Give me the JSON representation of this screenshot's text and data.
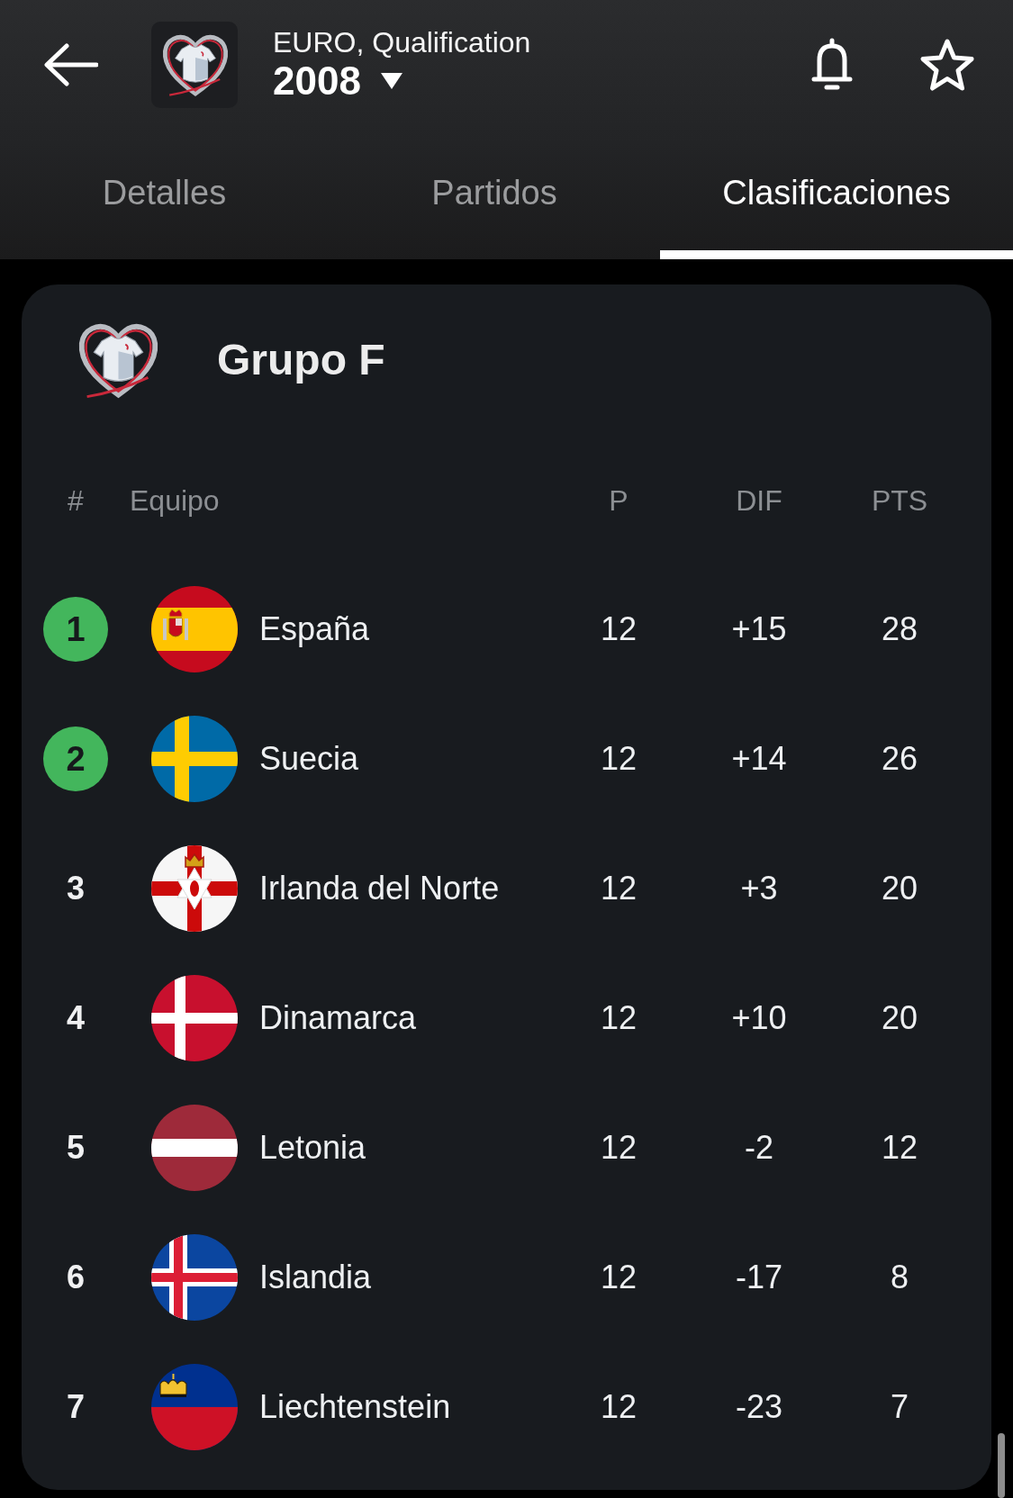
{
  "header": {
    "competition": "EURO, Qualification",
    "season": "2008"
  },
  "tabs": [
    {
      "label": "Detalles",
      "selected": false
    },
    {
      "label": "Partidos",
      "selected": false
    },
    {
      "label": "Clasificaciones",
      "selected": true
    }
  ],
  "group": {
    "title": "Grupo F"
  },
  "table": {
    "columns": [
      "#",
      "Equipo",
      "P",
      "DIF",
      "PTS"
    ],
    "rows": [
      {
        "rank": "1",
        "qualified": true,
        "kind": "spain",
        "team": "España",
        "played": "12",
        "goal_difference": "+15",
        "points": "28"
      },
      {
        "rank": "2",
        "qualified": true,
        "kind": "sweden",
        "team": "Suecia",
        "played": "12",
        "goal_difference": "+14",
        "points": "26"
      },
      {
        "rank": "3",
        "qualified": false,
        "kind": "northern-ireland",
        "team": "Irlanda del Norte",
        "played": "12",
        "goal_difference": "+3",
        "points": "20"
      },
      {
        "rank": "4",
        "qualified": false,
        "kind": "denmark",
        "team": "Dinamarca",
        "played": "12",
        "goal_difference": "+10",
        "points": "20"
      },
      {
        "rank": "5",
        "qualified": false,
        "kind": "latvia",
        "team": "Letonia",
        "played": "12",
        "goal_difference": "-2",
        "points": "12"
      },
      {
        "rank": "6",
        "qualified": false,
        "kind": "iceland",
        "team": "Islandia",
        "played": "12",
        "goal_difference": "-17",
        "points": "8"
      },
      {
        "rank": "7",
        "qualified": false,
        "kind": "liechtenstein",
        "team": "Liechtenstein",
        "played": "12",
        "goal_difference": "-23",
        "points": "7"
      }
    ]
  }
}
